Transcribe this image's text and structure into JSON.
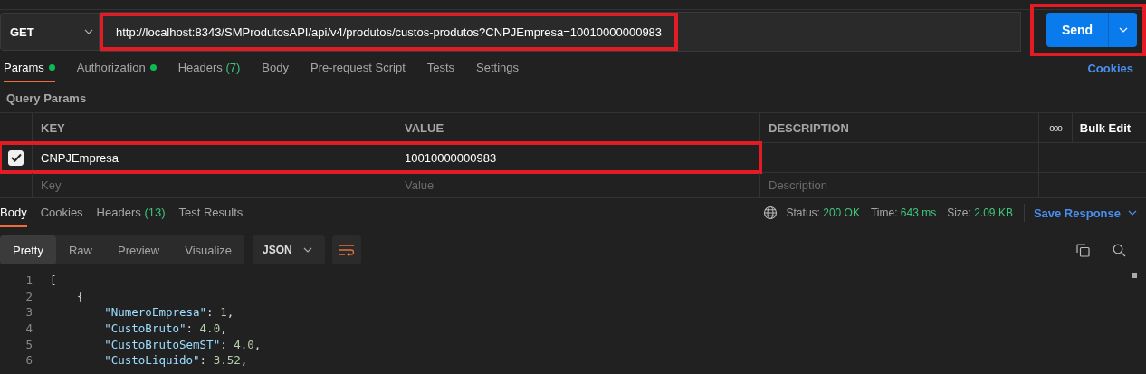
{
  "request": {
    "method": "GET",
    "url": "http://localhost:8343/SMProdutosAPI/api/v4/produtos/custos-produtos?CNPJEmpresa=10010000000983",
    "url_highlighted": true,
    "send": "Send",
    "send_highlighted": true
  },
  "request_tabs": [
    {
      "label": "Params",
      "selected": true,
      "dot": true
    },
    {
      "label": "Authorization",
      "selected": false,
      "dot": true
    },
    {
      "label": "Headers",
      "count": "(7)",
      "selected": false,
      "dot": false
    },
    {
      "label": "Body",
      "selected": false,
      "dot": false
    },
    {
      "label": "Pre-request Script",
      "selected": false,
      "dot": false
    },
    {
      "label": "Tests",
      "selected": false,
      "dot": false
    },
    {
      "label": "Settings",
      "selected": false,
      "dot": false
    }
  ],
  "cookies_link": "Cookies",
  "query_params": {
    "title": "Query Params",
    "columns": [
      "KEY",
      "VALUE",
      "DESCRIPTION"
    ],
    "more": "ooo",
    "bulk_edit": "Bulk Edit",
    "rows": [
      {
        "checked": true,
        "key": "CNPJEmpresa",
        "value": "10010000000983",
        "highlighted": true
      }
    ],
    "placeholders": {
      "key": "Key",
      "value": "Value",
      "description": "Description"
    }
  },
  "response_tabs": [
    {
      "label": "Body",
      "selected": true
    },
    {
      "label": "Cookies",
      "selected": false
    },
    {
      "label": "Headers",
      "count": "(13)",
      "selected": false
    },
    {
      "label": "Test Results",
      "selected": false
    }
  ],
  "response_meta": [
    {
      "label": "Status:",
      "value": "200 OK"
    },
    {
      "label": "Time:",
      "value": "643 ms"
    },
    {
      "label": "Size:",
      "value": "2.09 KB"
    }
  ],
  "save_response": "Save Response",
  "view_modes": [
    {
      "label": "Pretty",
      "selected": true
    },
    {
      "label": "Raw",
      "selected": false
    },
    {
      "label": "Preview",
      "selected": false
    },
    {
      "label": "Visualize",
      "selected": false
    }
  ],
  "format": "JSON",
  "code_lines": [
    {
      "number": "1",
      "code": "["
    },
    {
      "number": "2",
      "code": "    {"
    },
    {
      "number": "3",
      "code": "        \"NumeroEmpresa\": 1,"
    },
    {
      "number": "4",
      "code": "        \"CustoBruto\": 4.0,"
    },
    {
      "number": "5",
      "code": "        \"CustoBrutoSemST\": 4.0,"
    },
    {
      "number": "6",
      "code": "        \"CustoLiquido\": 3.52,"
    }
  ]
}
